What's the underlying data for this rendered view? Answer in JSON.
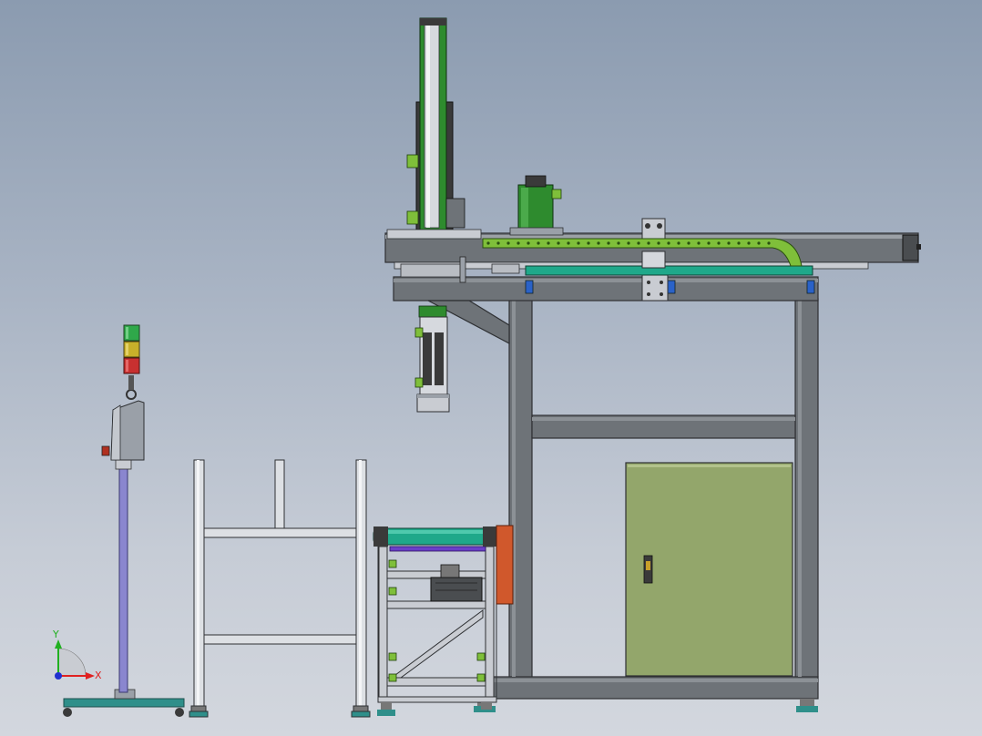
{
  "window": {
    "title": ""
  },
  "viewport": {
    "background_top": "#8b9bb0",
    "background_bottom": "#d3d7de"
  },
  "triad": {
    "x_label": "X",
    "y_label": "Y",
    "x_color": "#e02020",
    "y_color": "#20b020",
    "origin_color": "#2030d0"
  },
  "colors": {
    "frame": "#6e7378",
    "frame_dark": "#3c3f42",
    "cabinet": "#93a66b",
    "motor": "#2e8b2e",
    "drag_chain": "#7fbf3a",
    "roller": "#1fa88a",
    "belt_orange": "#d0582c",
    "tower_green": "#2fa84a",
    "tower_yellow": "#c8b02a",
    "tower_red": "#c83030",
    "fixture_blue": "#2a62c8"
  },
  "model": {
    "components": [
      "signal-tower-stand",
      "aluminium-rack",
      "belt-conveyor",
      "gantry-frame",
      "electrical-cabinet",
      "z-axis-column",
      "x-axis-beam",
      "servo-motor",
      "cable-drag-chain",
      "gripper"
    ]
  }
}
